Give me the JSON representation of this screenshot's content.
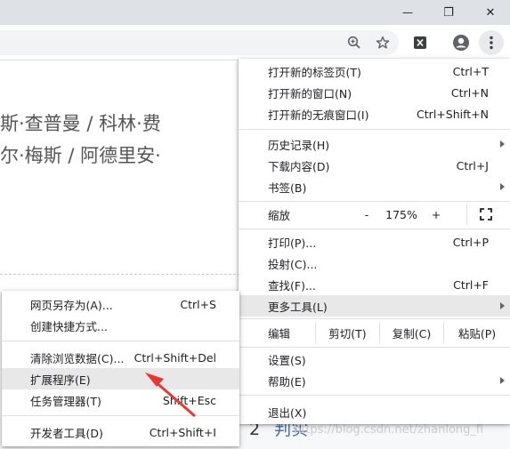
{
  "window": {
    "minimize_glyph": "—",
    "restore_glyph": "❐",
    "close_glyph": "✕"
  },
  "toolbar": {
    "icons": [
      "zoom-icon",
      "star-icon",
      "extension-icon",
      "profile-icon",
      "kebab-menu-icon"
    ]
  },
  "page": {
    "author_line_1": "斯·查普曼 / 科林·费",
    "author_line_2": "尔·梅斯 / 阿德里安·",
    "section_number": "2",
    "section_title": "判实",
    "watermark": "https://blog.csdn.net/zhanlong_fi"
  },
  "main_menu": {
    "new_tab": {
      "label": "打开新的标签页(T)",
      "shortcut": "Ctrl+T"
    },
    "new_window": {
      "label": "打开新的窗口(N)",
      "shortcut": "Ctrl+N"
    },
    "new_incognito": {
      "label": "打开新的无痕窗口(I)",
      "shortcut": "Ctrl+Shift+N"
    },
    "history": {
      "label": "历史记录(H)"
    },
    "downloads": {
      "label": "下载内容(D)",
      "shortcut": "Ctrl+J"
    },
    "bookmarks": {
      "label": "书签(B)"
    },
    "zoom": {
      "label": "缩放",
      "minus": "-",
      "value": "175%",
      "plus": "+"
    },
    "print": {
      "label": "打印(P)...",
      "shortcut": "Ctrl+P"
    },
    "cast": {
      "label": "投射(C)..."
    },
    "find": {
      "label": "查找(F)...",
      "shortcut": "Ctrl+F"
    },
    "more_tools": {
      "label": "更多工具(L)"
    },
    "edit": {
      "label": "编辑",
      "cut": "剪切(T)",
      "copy": "复制(C)",
      "paste": "粘贴(P)"
    },
    "settings": {
      "label": "设置(S)"
    },
    "help": {
      "label": "帮助(E)"
    },
    "exit": {
      "label": "退出(X)"
    }
  },
  "sub_menu": {
    "save_page": {
      "label": "网页另存为(A)...",
      "shortcut": "Ctrl+S"
    },
    "create_shortcut": {
      "label": "创建快捷方式..."
    },
    "clear_data": {
      "label": "清除浏览数据(C)...",
      "shortcut": "Ctrl+Shift+Del"
    },
    "extensions": {
      "label": "扩展程序(E)"
    },
    "task_manager": {
      "label": "任务管理器(T)",
      "shortcut": "Shift+Esc"
    },
    "dev_tools": {
      "label": "开发者工具(D)",
      "shortcut": "Ctrl+Shift+I"
    }
  },
  "colors": {
    "highlight": "#e8e8e8",
    "annotation_arrow": "#e53935"
  }
}
